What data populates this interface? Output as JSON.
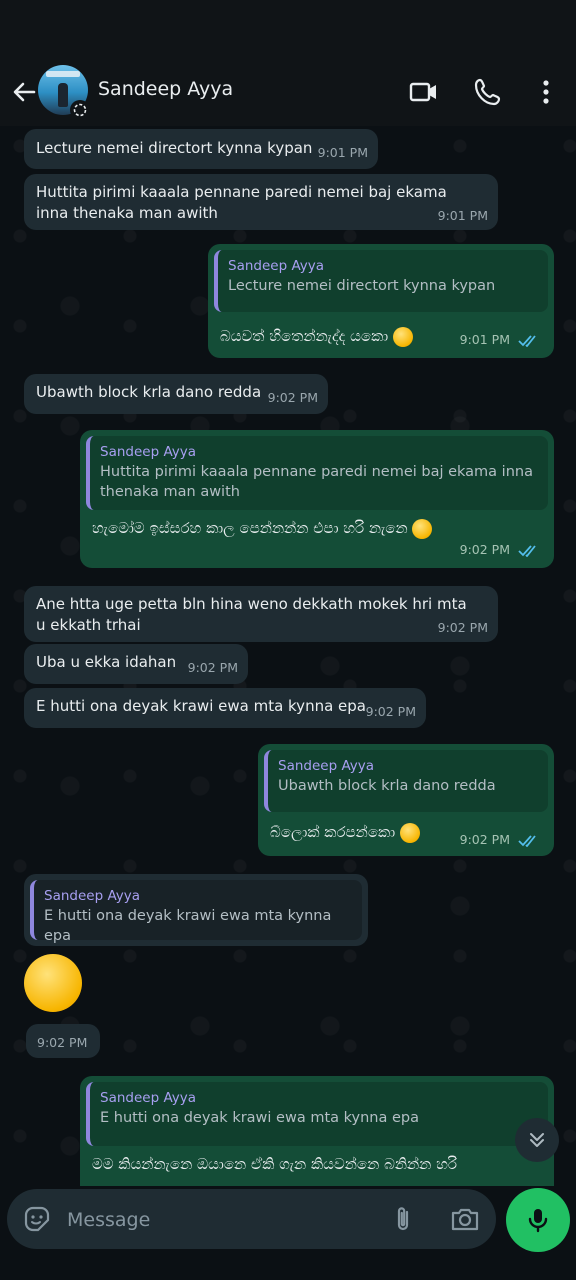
{
  "header": {
    "contact_name": "Sandeep Ayya"
  },
  "messages": [
    {
      "dir": "in",
      "text": "Lecture nemei directort kynna kypan",
      "time": "9:01 PM"
    },
    {
      "dir": "in",
      "text": "Huttita pirimi kaaala pennane paredi nemei baj ekama inna thenaka man awith",
      "time": "9:01 PM"
    },
    {
      "dir": "out",
      "quote_name": "Sandeep Ayya",
      "quote_text": "Lecture nemei directort kynna kypan",
      "text": "බයවත් හිතෙන්නැද්ද යකො",
      "time": "9:01 PM",
      "emoji": "joy"
    },
    {
      "dir": "in",
      "text": "Ubawth block krla dano redda",
      "time": "9:02 PM"
    },
    {
      "dir": "out",
      "quote_name": "Sandeep Ayya",
      "quote_text": "Huttita pirimi kaaala pennane paredi nemei baj ekama inna thenaka man awith",
      "text": "හැමෝම ඉස්සරහ කාල පෙන්නන්න එපා හරි නැනෙ",
      "time": "9:02 PM",
      "emoji": "sad"
    },
    {
      "dir": "in",
      "text": "Ane htta uge petta bln hina weno dekkath mokek hri mta  u ekkath trhai",
      "time": "9:02 PM"
    },
    {
      "dir": "in",
      "text": "Uba u ekka idahan",
      "time": "9:02 PM"
    },
    {
      "dir": "in",
      "text": "E hutti ona deyak krawi ewa mta kynna epa",
      "time": "9:02 PM"
    },
    {
      "dir": "out",
      "quote_name": "Sandeep Ayya",
      "quote_text": "Ubawth block krla dano redda",
      "text": "බ්ලොක් කරපන්කො",
      "time": "9:02 PM",
      "emoji": "smirk"
    },
    {
      "dir": "in",
      "quote_name": "Sandeep Ayya",
      "quote_text": "E hutti ona deyak krawi ewa mta kynna epa",
      "emoji": "smirk",
      "time": "9:02 PM"
    },
    {
      "dir": "out",
      "quote_name": "Sandeep Ayya",
      "quote_text": "E hutti ona deyak krawi ewa mta kynna epa",
      "text": "මම කියන්නැනෙ ඔයානෙ ඒකි ගැන කියවන්නෙ බනින්න හරි"
    }
  ],
  "composer": {
    "placeholder": "Message"
  },
  "colors": {
    "incoming_bubble": "#1f2c33",
    "outgoing_bubble": "#144d37",
    "accent": "#21c063",
    "read_ticks": "#53bdeb"
  },
  "icons": [
    "back-arrow-icon",
    "video-call-icon",
    "voice-call-icon",
    "more-options-icon",
    "sticker-icon",
    "attach-icon",
    "camera-icon",
    "mic-icon",
    "scroll-down-icon"
  ]
}
